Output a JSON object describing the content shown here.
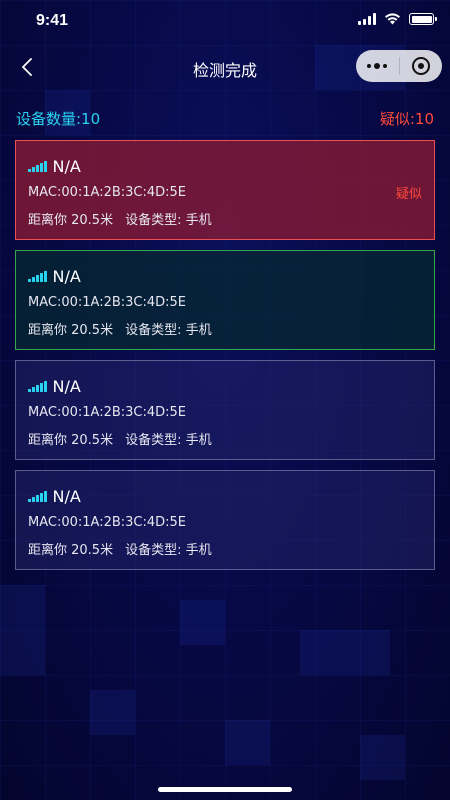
{
  "status_bar": {
    "time": "9:41"
  },
  "nav": {
    "title": "检测完成"
  },
  "summary": {
    "device_count": "设备数量:10",
    "suspect_count": "疑似:10"
  },
  "devices": [
    {
      "name": "N/A",
      "mac": "MAC:00:1A:2B:3C:4D:5E",
      "distance": "距离你 20.5米",
      "type": "设备类型: 手机",
      "tag": "疑似",
      "status": "suspect"
    },
    {
      "name": "N/A",
      "mac": "MAC:00:1A:2B:3C:4D:5E",
      "distance": "距离你 20.5米",
      "type": "设备类型: 手机",
      "tag": "",
      "status": "safe"
    },
    {
      "name": "N/A",
      "mac": "MAC:00:1A:2B:3C:4D:5E",
      "distance": "距离你 20.5米",
      "type": "设备类型: 手机",
      "tag": "",
      "status": "normal"
    },
    {
      "name": "N/A",
      "mac": "MAC:00:1A:2B:3C:4D:5E",
      "distance": "距离你 20.5米",
      "type": "设备类型: 手机",
      "tag": "",
      "status": "normal"
    }
  ],
  "icons": {
    "back": "chevron-left-icon",
    "more": "more-dots-icon",
    "close": "target-circle-icon",
    "signal": "signal-strength-icon"
  },
  "colors": {
    "accent_cyan": "#29d4f0",
    "suspect_red": "#ff4a3a",
    "background": "#05063d"
  }
}
